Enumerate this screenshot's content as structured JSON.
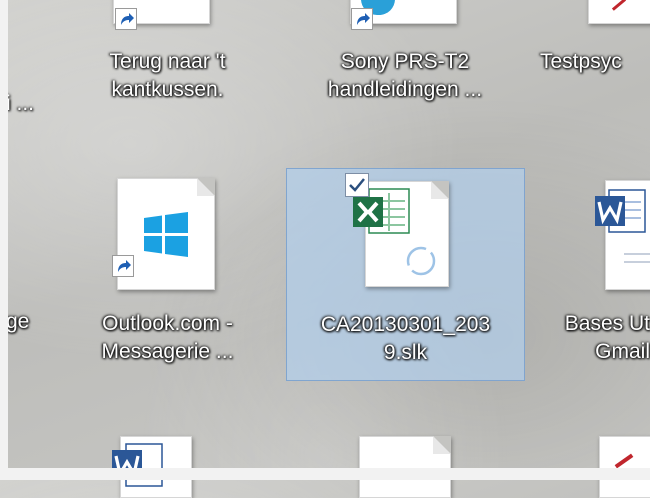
{
  "desktop": {
    "icons": [
      {
        "label_lines": [
          "Terug naar 't",
          "kantkussen."
        ],
        "icon": "shortcut-icon"
      },
      {
        "label_lines": [
          "Sony  PRS-T2",
          "handleidingen  ..."
        ],
        "icon": "shortcut-icon"
      },
      {
        "label_lines": [
          "Testpsyc"
        ],
        "icon": "document-icon"
      },
      {
        "label_lines": [
          "i ..."
        ]
      },
      {
        "label_lines": [
          "ge"
        ]
      },
      {
        "label_lines": [
          "Outlook.com -",
          "Messagerie ..."
        ],
        "icon": "windows-logo-icon"
      },
      {
        "label_lines": [
          "CA20130301_203",
          "9.slk"
        ],
        "icon": "excel-icon",
        "selected": true
      },
      {
        "label_lines": [
          "Bases Ut",
          "Gmail"
        ],
        "icon": "word-icon"
      }
    ]
  },
  "colors": {
    "selection": "#b2ceec",
    "windows_tile": "#1ba1e2",
    "excel_green": "#1f7246",
    "word_blue": "#2b5797",
    "shortcut_arrow": "#1e5fb4"
  }
}
